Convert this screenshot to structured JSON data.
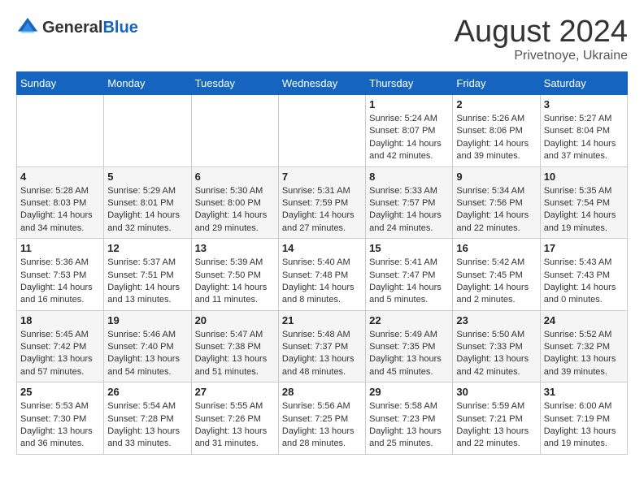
{
  "logo": {
    "general": "General",
    "blue": "Blue"
  },
  "header": {
    "month": "August 2024",
    "location": "Privetnoye, Ukraine"
  },
  "weekdays": [
    "Sunday",
    "Monday",
    "Tuesday",
    "Wednesday",
    "Thursday",
    "Friday",
    "Saturday"
  ],
  "weeks": [
    [
      {
        "day": "",
        "info": ""
      },
      {
        "day": "",
        "info": ""
      },
      {
        "day": "",
        "info": ""
      },
      {
        "day": "",
        "info": ""
      },
      {
        "day": "1",
        "info": "Sunrise: 5:24 AM\nSunset: 8:07 PM\nDaylight: 14 hours\nand 42 minutes."
      },
      {
        "day": "2",
        "info": "Sunrise: 5:26 AM\nSunset: 8:06 PM\nDaylight: 14 hours\nand 39 minutes."
      },
      {
        "day": "3",
        "info": "Sunrise: 5:27 AM\nSunset: 8:04 PM\nDaylight: 14 hours\nand 37 minutes."
      }
    ],
    [
      {
        "day": "4",
        "info": "Sunrise: 5:28 AM\nSunset: 8:03 PM\nDaylight: 14 hours\nand 34 minutes."
      },
      {
        "day": "5",
        "info": "Sunrise: 5:29 AM\nSunset: 8:01 PM\nDaylight: 14 hours\nand 32 minutes."
      },
      {
        "day": "6",
        "info": "Sunrise: 5:30 AM\nSunset: 8:00 PM\nDaylight: 14 hours\nand 29 minutes."
      },
      {
        "day": "7",
        "info": "Sunrise: 5:31 AM\nSunset: 7:59 PM\nDaylight: 14 hours\nand 27 minutes."
      },
      {
        "day": "8",
        "info": "Sunrise: 5:33 AM\nSunset: 7:57 PM\nDaylight: 14 hours\nand 24 minutes."
      },
      {
        "day": "9",
        "info": "Sunrise: 5:34 AM\nSunset: 7:56 PM\nDaylight: 14 hours\nand 22 minutes."
      },
      {
        "day": "10",
        "info": "Sunrise: 5:35 AM\nSunset: 7:54 PM\nDaylight: 14 hours\nand 19 minutes."
      }
    ],
    [
      {
        "day": "11",
        "info": "Sunrise: 5:36 AM\nSunset: 7:53 PM\nDaylight: 14 hours\nand 16 minutes."
      },
      {
        "day": "12",
        "info": "Sunrise: 5:37 AM\nSunset: 7:51 PM\nDaylight: 14 hours\nand 13 minutes."
      },
      {
        "day": "13",
        "info": "Sunrise: 5:39 AM\nSunset: 7:50 PM\nDaylight: 14 hours\nand 11 minutes."
      },
      {
        "day": "14",
        "info": "Sunrise: 5:40 AM\nSunset: 7:48 PM\nDaylight: 14 hours\nand 8 minutes."
      },
      {
        "day": "15",
        "info": "Sunrise: 5:41 AM\nSunset: 7:47 PM\nDaylight: 14 hours\nand 5 minutes."
      },
      {
        "day": "16",
        "info": "Sunrise: 5:42 AM\nSunset: 7:45 PM\nDaylight: 14 hours\nand 2 minutes."
      },
      {
        "day": "17",
        "info": "Sunrise: 5:43 AM\nSunset: 7:43 PM\nDaylight: 14 hours\nand 0 minutes."
      }
    ],
    [
      {
        "day": "18",
        "info": "Sunrise: 5:45 AM\nSunset: 7:42 PM\nDaylight: 13 hours\nand 57 minutes."
      },
      {
        "day": "19",
        "info": "Sunrise: 5:46 AM\nSunset: 7:40 PM\nDaylight: 13 hours\nand 54 minutes."
      },
      {
        "day": "20",
        "info": "Sunrise: 5:47 AM\nSunset: 7:38 PM\nDaylight: 13 hours\nand 51 minutes."
      },
      {
        "day": "21",
        "info": "Sunrise: 5:48 AM\nSunset: 7:37 PM\nDaylight: 13 hours\nand 48 minutes."
      },
      {
        "day": "22",
        "info": "Sunrise: 5:49 AM\nSunset: 7:35 PM\nDaylight: 13 hours\nand 45 minutes."
      },
      {
        "day": "23",
        "info": "Sunrise: 5:50 AM\nSunset: 7:33 PM\nDaylight: 13 hours\nand 42 minutes."
      },
      {
        "day": "24",
        "info": "Sunrise: 5:52 AM\nSunset: 7:32 PM\nDaylight: 13 hours\nand 39 minutes."
      }
    ],
    [
      {
        "day": "25",
        "info": "Sunrise: 5:53 AM\nSunset: 7:30 PM\nDaylight: 13 hours\nand 36 minutes."
      },
      {
        "day": "26",
        "info": "Sunrise: 5:54 AM\nSunset: 7:28 PM\nDaylight: 13 hours\nand 33 minutes."
      },
      {
        "day": "27",
        "info": "Sunrise: 5:55 AM\nSunset: 7:26 PM\nDaylight: 13 hours\nand 31 minutes."
      },
      {
        "day": "28",
        "info": "Sunrise: 5:56 AM\nSunset: 7:25 PM\nDaylight: 13 hours\nand 28 minutes."
      },
      {
        "day": "29",
        "info": "Sunrise: 5:58 AM\nSunset: 7:23 PM\nDaylight: 13 hours\nand 25 minutes."
      },
      {
        "day": "30",
        "info": "Sunrise: 5:59 AM\nSunset: 7:21 PM\nDaylight: 13 hours\nand 22 minutes."
      },
      {
        "day": "31",
        "info": "Sunrise: 6:00 AM\nSunset: 7:19 PM\nDaylight: 13 hours\nand 19 minutes."
      }
    ]
  ]
}
